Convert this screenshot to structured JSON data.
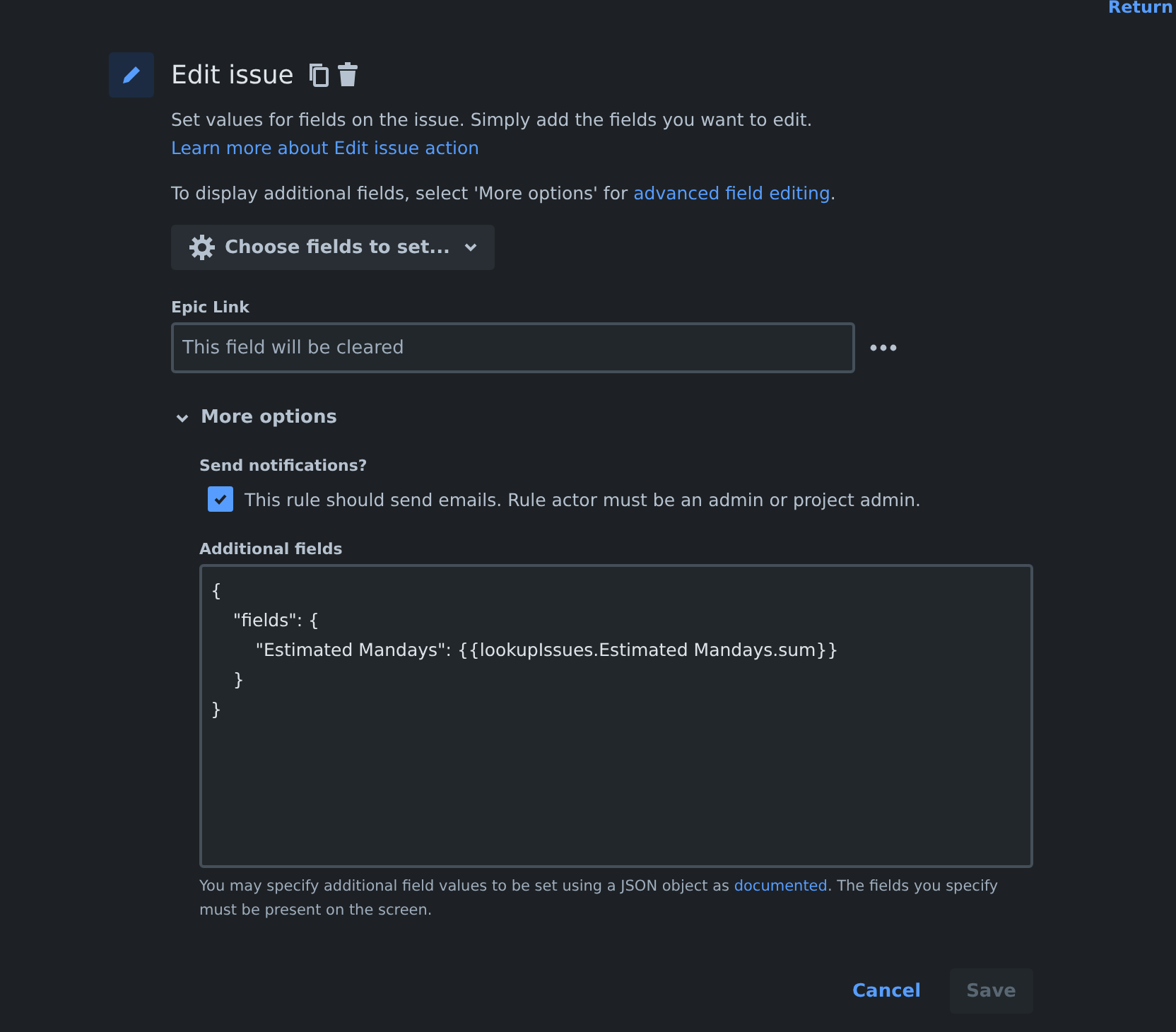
{
  "top_link": "Return",
  "action": {
    "title": "Edit issue",
    "description": {
      "text": "Set values for fields on the issue. Simply add the fields you want to edit. ",
      "link": "Learn more about Edit issue action"
    },
    "hint": {
      "before": "To display additional fields, select 'More options' for ",
      "link": "advanced field editing",
      "after": "."
    },
    "choose_button": "Choose fields to set...",
    "fields": [
      {
        "label": "Epic Link",
        "placeholder": "This field will be cleared"
      }
    ],
    "more_options": {
      "label": "More options",
      "expanded": true,
      "notifications": {
        "label": "Send notifications?",
        "checkbox": "This rule should send emails. Rule actor must be an admin or project admin.",
        "checked": true
      },
      "additional_fields": {
        "label": "Additional fields",
        "lines": [
          "{",
          "    \"fields\": {",
          "        \"Estimated Mandays\": {{lookupIssues.Estimated Mandays.sum}}",
          "    }",
          "}"
        ],
        "help": {
          "before": "You may specify additional field values to be set using a JSON object as ",
          "link": "documented",
          "after": ". The fields you specify must be present on the screen."
        }
      }
    }
  },
  "buttons": [
    {
      "label": "Cancel",
      "kind": "link",
      "disabled": false
    },
    {
      "label": "Save",
      "kind": "primary",
      "disabled": true
    }
  ]
}
